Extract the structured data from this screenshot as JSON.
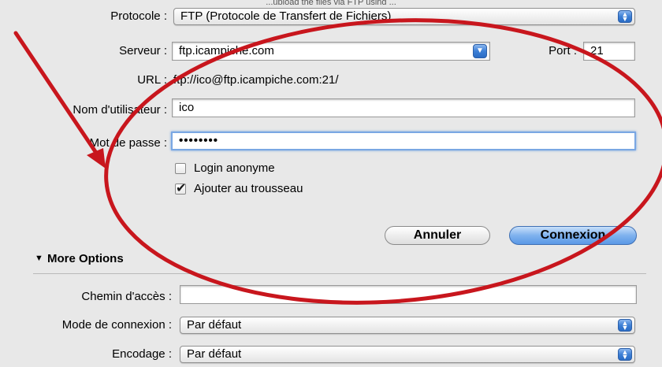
{
  "window": {
    "partial_title": "...upload the files via FTP using ..."
  },
  "form": {
    "protocol": {
      "label": "Protocole :",
      "value": "FTP (Protocole de Transfert de Fichiers)"
    },
    "server": {
      "label": "Serveur :",
      "value": "ftp.icampiche.com"
    },
    "port": {
      "label": "Port :",
      "value": "21"
    },
    "url": {
      "label": "URL :",
      "value": "ftp://ico@ftp.icampiche.com:21/"
    },
    "username": {
      "label": "Nom d'utilisateur :",
      "value": "ico"
    },
    "password": {
      "label": "Mot de passe :",
      "value": "••••••••"
    },
    "anonymous_login": {
      "label": "Login anonyme",
      "checked": false
    },
    "add_keychain": {
      "label": "Ajouter au trousseau",
      "checked": true,
      "mark": "✔"
    }
  },
  "buttons": {
    "cancel": "Annuler",
    "connect": "Connexion"
  },
  "more_options": {
    "disclosure": "▼",
    "title": "More Options",
    "path": {
      "label": "Chemin d'accès :",
      "value": ""
    },
    "connection_mode": {
      "label": "Mode de connexion :",
      "value": "Par défaut"
    },
    "encoding": {
      "label": "Encodage :",
      "value": "Par défaut"
    }
  },
  "annotation": {
    "color": "#c8161d"
  },
  "icons": {
    "stepper": "up-down-arrows-icon",
    "combo": "chevron-down-icon"
  }
}
